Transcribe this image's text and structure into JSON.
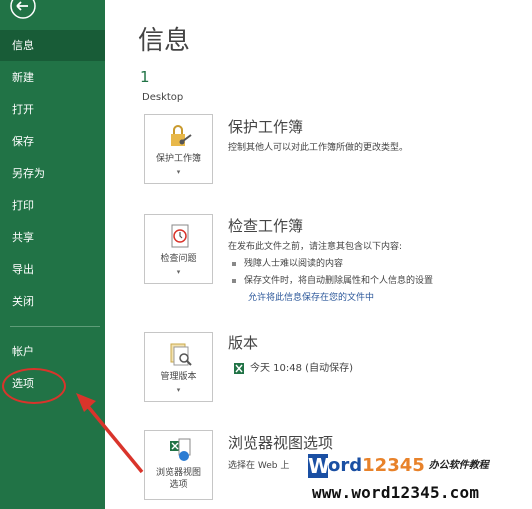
{
  "sidebar": {
    "items": [
      {
        "label": "信息",
        "selected": true
      },
      {
        "label": "新建"
      },
      {
        "label": "打开"
      },
      {
        "label": "保存"
      },
      {
        "label": "另存为"
      },
      {
        "label": "打印"
      },
      {
        "label": "共享"
      },
      {
        "label": "导出"
      },
      {
        "label": "关闭"
      }
    ],
    "lower_items": [
      {
        "label": "帐户"
      },
      {
        "label": "选项"
      }
    ],
    "back_icon": "back-arrow-icon",
    "bg_color": "#217346"
  },
  "main": {
    "title": "信息",
    "doc_number": "1",
    "doc_location": "Desktop",
    "sections": [
      {
        "tile_label": "保护工作簿",
        "icon": "lock-key-icon",
        "title": "保护工作簿",
        "desc": "控制其他人可以对此工作簿所做的更改类型。"
      },
      {
        "tile_label": "检查问题",
        "icon": "inspect-document-icon",
        "title": "检查工作簿",
        "desc": "在发布此文件之前，请注意其包含以下内容:",
        "bullets": [
          "残障人士难以阅读的内容",
          "保存文件时，将自动删除属性和个人信息的设置"
        ],
        "link": "允许将此信息保存在您的文件中"
      },
      {
        "tile_label": "管理版本",
        "icon": "manage-versions-icon",
        "title": "版本",
        "version_entry": "今天 10:48 (自动保存)"
      },
      {
        "tile_label_line1": "浏览器视图",
        "tile_label_line2": "选项",
        "icon": "browser-view-icon",
        "title": "浏览器视图选项",
        "desc": "选择在 Web 上"
      }
    ]
  },
  "watermark": {
    "brand_w": "W",
    "brand_ord": "ord",
    "brand_num": "12345",
    "brand_cn": "办公软件教程",
    "url": "www.word12345.com"
  },
  "annotation_color": "#d9342b"
}
